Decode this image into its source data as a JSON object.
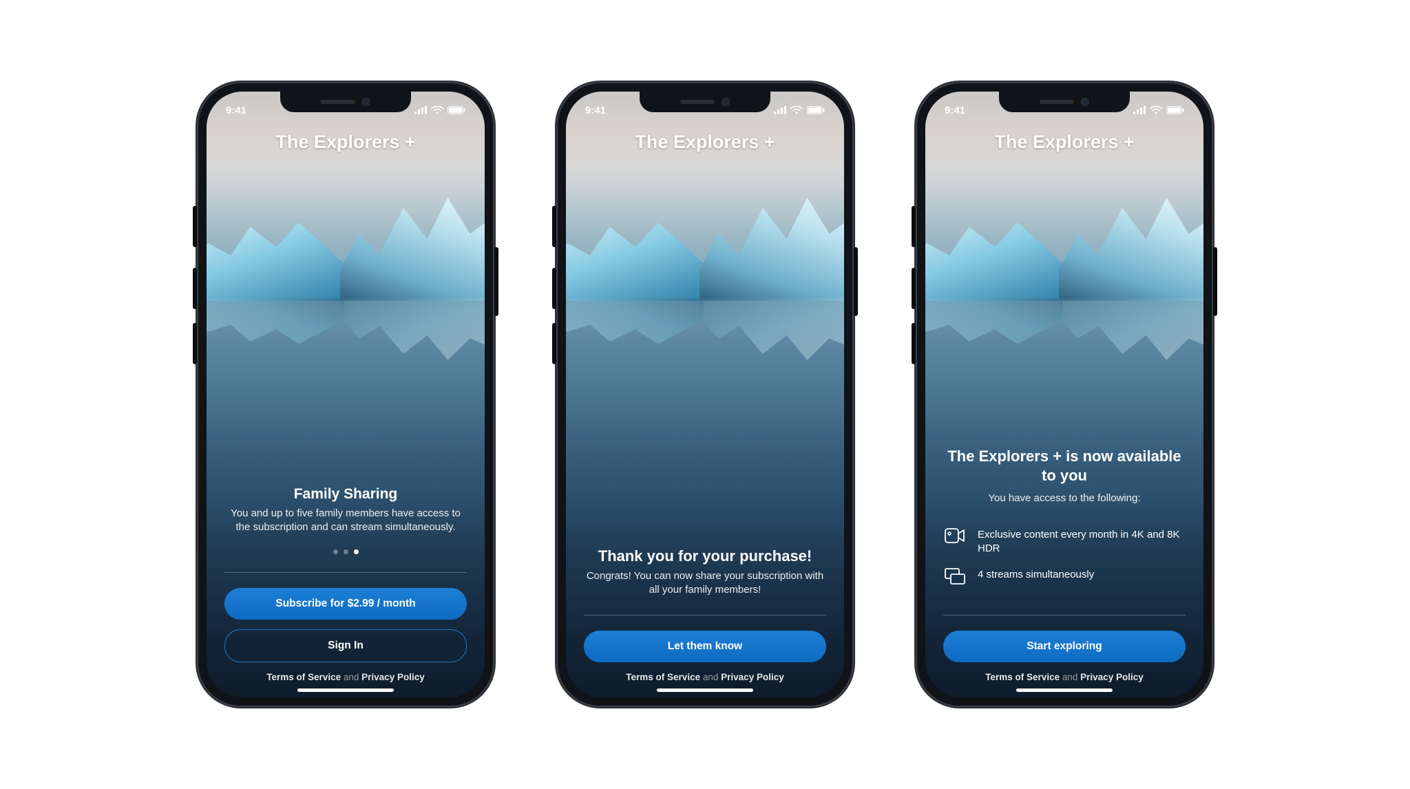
{
  "status": {
    "time": "9:41"
  },
  "brand": "The Explorers +",
  "legal": {
    "tos": "Terms of Service",
    "and": "and",
    "privacy": "Privacy Policy"
  },
  "screens": [
    {
      "heading": "Family Sharing",
      "subtext": "You and up to five family members have access to the subscription and can stream simultaneously.",
      "pager": {
        "count": 3,
        "active_index": 2
      },
      "primary_cta": "Subscribe for $2.99 / month",
      "secondary_cta": "Sign In"
    },
    {
      "heading": "Thank you for your purchase!",
      "subtext": "Congrats! You can now share your subscription with all your family members!",
      "primary_cta": "Let them know"
    },
    {
      "heading": "The Explorers + is now available to you",
      "subtext": "You have access to the following:",
      "features": [
        {
          "icon": "video-icon",
          "text": "Exclusive content every month in 4K and 8K HDR"
        },
        {
          "icon": "streams-icon",
          "text": "4 streams simultaneously"
        }
      ],
      "primary_cta": "Start exploring"
    }
  ]
}
